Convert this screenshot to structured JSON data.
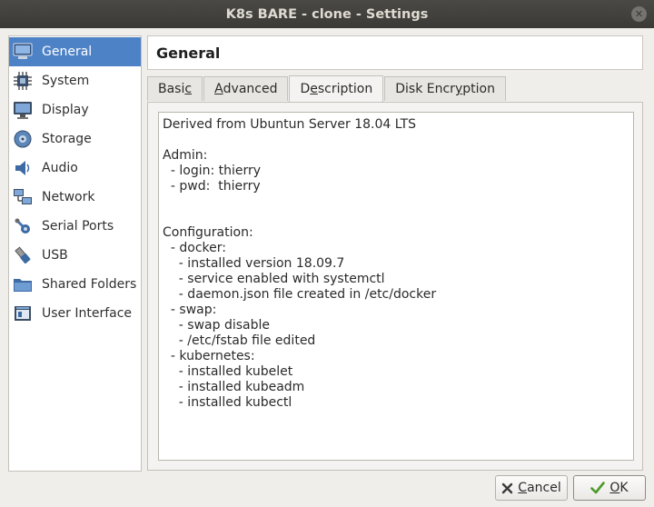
{
  "window": {
    "title": "K8s BARE - clone - Settings",
    "close_glyph": "✕"
  },
  "sidebar": {
    "items": [
      {
        "label": "General",
        "icon": "general-icon"
      },
      {
        "label": "System",
        "icon": "chip-icon"
      },
      {
        "label": "Display",
        "icon": "monitor-icon"
      },
      {
        "label": "Storage",
        "icon": "disk-icon"
      },
      {
        "label": "Audio",
        "icon": "speaker-icon"
      },
      {
        "label": "Network",
        "icon": "network-icon"
      },
      {
        "label": "Serial Ports",
        "icon": "serial-port-icon"
      },
      {
        "label": "USB",
        "icon": "usb-icon"
      },
      {
        "label": "Shared Folders",
        "icon": "folder-icon"
      },
      {
        "label": "User Interface",
        "icon": "user-interface-icon"
      }
    ],
    "selected": "General",
    "accent": "#4d82c6"
  },
  "header": {
    "title": "General"
  },
  "tabs": {
    "basic": {
      "pre": "Basi",
      "mnemonic": "c",
      "post": ""
    },
    "advanced": {
      "pre": "",
      "mnemonic": "A",
      "post": "dvanced"
    },
    "description": {
      "pre": "D",
      "mnemonic": "e",
      "post": "scription"
    },
    "disk_encryption": {
      "pre": "Disk Encr",
      "mnemonic": "y",
      "post": "ption"
    },
    "active": "Description"
  },
  "description": {
    "text": "Derived from Ubuntun Server 18.04 LTS\n\nAdmin:\n  - login: thierry\n  - pwd:  thierry\n\n\nConfiguration:\n  - docker:\n    - installed version 18.09.7\n    - service enabled with systemctl\n    - daemon.json file created in /etc/docker\n  - swap:\n    - swap disable\n    - /etc/fstab file edited\n  - kubernetes:\n    - installed kubelet\n    - installed kubeadm\n    - installed kubectl"
  },
  "buttons": {
    "cancel": {
      "mnemonic": "C",
      "rest": "ancel",
      "icon": "cancel-x-icon"
    },
    "ok": {
      "mnemonic": "O",
      "rest": "K",
      "icon": "checkmark-icon"
    }
  }
}
